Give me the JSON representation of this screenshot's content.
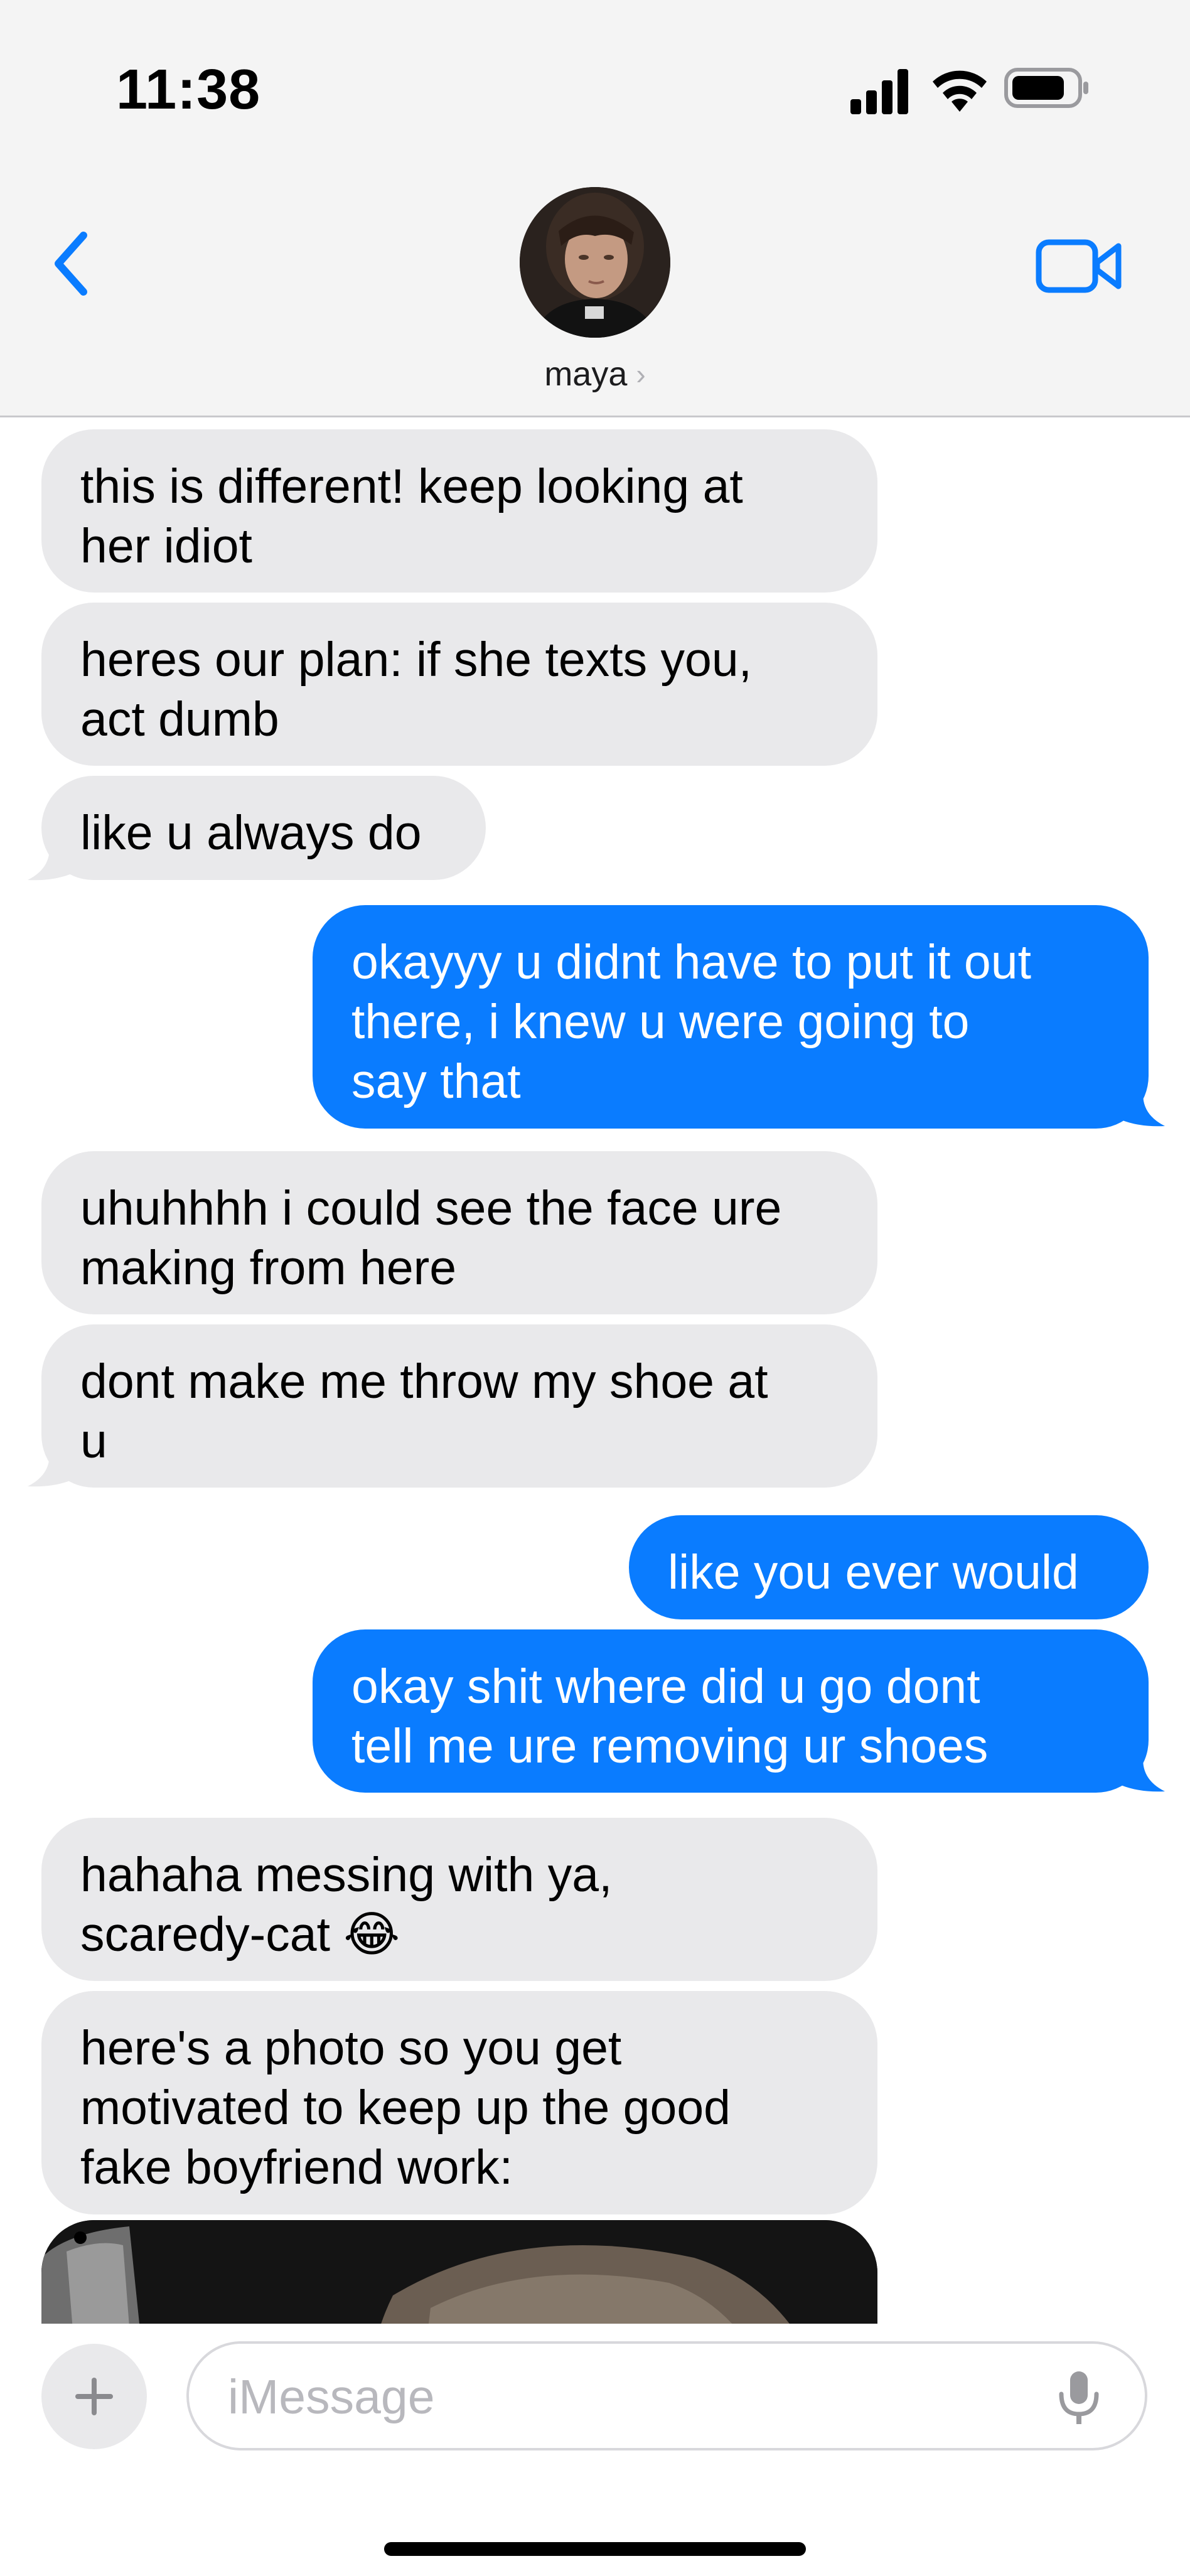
{
  "status_bar": {
    "time": "11:38"
  },
  "header": {
    "contact_name": "maya",
    "chevron": "›"
  },
  "icons": {
    "back": "chevron-left-icon",
    "video": "video-camera-icon",
    "signal": "cellular-signal-icon",
    "wifi": "wifi-icon",
    "battery": "battery-icon",
    "plus": "plus-icon",
    "mic": "microphone-icon"
  },
  "colors": {
    "accent": "#0a7cff",
    "incoming_bubble": "#e9e9eb",
    "header_bg": "#f4f4f4"
  },
  "messages": [
    {
      "side": "incoming",
      "text": "this is different! keep looking at\nher idiot"
    },
    {
      "side": "incoming",
      "text": "heres our plan: if she texts you,\nact dumb"
    },
    {
      "side": "incoming",
      "text": "like u always do"
    },
    {
      "side": "outgoing",
      "text": "okayyy u didnt have to put it out\nthere, i knew u were going to\nsay that"
    },
    {
      "side": "incoming",
      "text": "uhuhhhh i could see the face ure\nmaking from here"
    },
    {
      "side": "incoming",
      "text": "dont make me throw my shoe at\nu"
    },
    {
      "side": "outgoing",
      "text": "like you ever would"
    },
    {
      "side": "outgoing",
      "text": "okay shit where did u go dont\ntell me ure removing ur shoes"
    },
    {
      "side": "incoming",
      "text": "hahaha messing with ya,\nscaredy-cat 😂"
    },
    {
      "side": "incoming",
      "text": "here's a photo so you get\nmotivated to keep up the good\nfake boyfriend work:"
    }
  ],
  "input": {
    "placeholder": "iMessage",
    "value": ""
  }
}
